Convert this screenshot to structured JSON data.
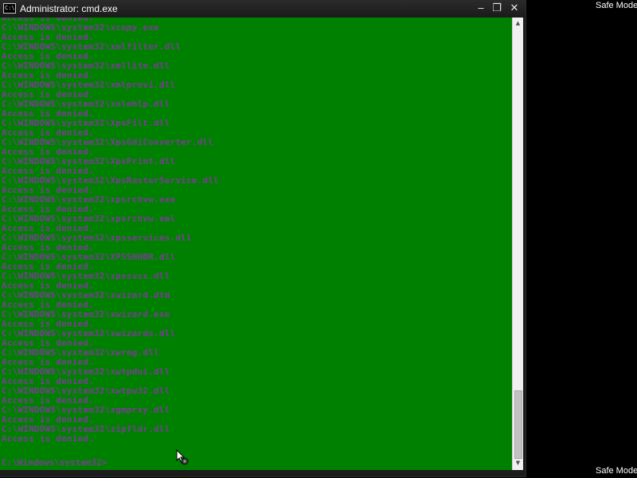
{
  "window": {
    "title": "Administrator: cmd.exe",
    "icon_name": "cmd-icon",
    "icon_text": "C:\\",
    "buttons": {
      "minimize": "‒",
      "restore": "❐",
      "close": "✕"
    }
  },
  "colors": {
    "console_background": "#008000",
    "console_text": "#7a3c96",
    "titlebar": "#1f1f1f",
    "desktop": "#000000"
  },
  "console": {
    "lines": [
      "Access is denied.",
      "C:\\WINDOWS\\system32\\xcopy.exe",
      "Access is denied.",
      "C:\\WINDOWS\\system32\\xmlfilter.dll",
      "Access is denied.",
      "C:\\WINDOWS\\system32\\xmllite.dll",
      "Access is denied.",
      "C:\\WINDOWS\\system32\\xmlprovi.dll",
      "Access is denied.",
      "C:\\WINDOWS\\system32\\xolehlp.dll",
      "Access is denied.",
      "C:\\WINDOWS\\system32\\XpsFilt.dll",
      "Access is denied.",
      "C:\\WINDOWS\\system32\\XpsGdiConverter.dll",
      "Access is denied.",
      "C:\\WINDOWS\\system32\\XpsPrint.dll",
      "Access is denied.",
      "C:\\WINDOWS\\system32\\XpsRasterService.dll",
      "Access is denied.",
      "C:\\WINDOWS\\system32\\xpsrchvw.exe",
      "Access is denied.",
      "C:\\WINDOWS\\system32\\xpsrchvw.xml",
      "Access is denied.",
      "C:\\WINDOWS\\system32\\xpsservices.dll",
      "Access is denied.",
      "C:\\WINDOWS\\system32\\XPSSHHDR.dll",
      "Access is denied.",
      "C:\\WINDOWS\\system32\\xpssvcs.dll",
      "Access is denied.",
      "C:\\WINDOWS\\system32\\xwizard.dtd",
      "Access is denied.",
      "C:\\WINDOWS\\system32\\xwizard.exe",
      "Access is denied.",
      "C:\\WINDOWS\\system32\\xwizards.dll",
      "Access is denied.",
      "C:\\WINDOWS\\system32\\xwreg.dll",
      "Access is denied.",
      "C:\\WINDOWS\\system32\\xwtpdui.dll",
      "Access is denied.",
      "C:\\WINDOWS\\system32\\xwtpw32.dll",
      "Access is denied.",
      "C:\\WINDOWS\\system32\\zgmprxy.dll",
      "Access is denied.",
      "C:\\WINDOWS\\system32\\zipfldr.dll",
      "Access is denied."
    ],
    "prompt": "C:\\Windows\\system32>"
  },
  "scrollbar": {
    "up_arrow": "▲",
    "down_arrow": "▼",
    "position": 0.98
  },
  "desktop": {
    "safe_mode_label": "Safe Mode"
  }
}
